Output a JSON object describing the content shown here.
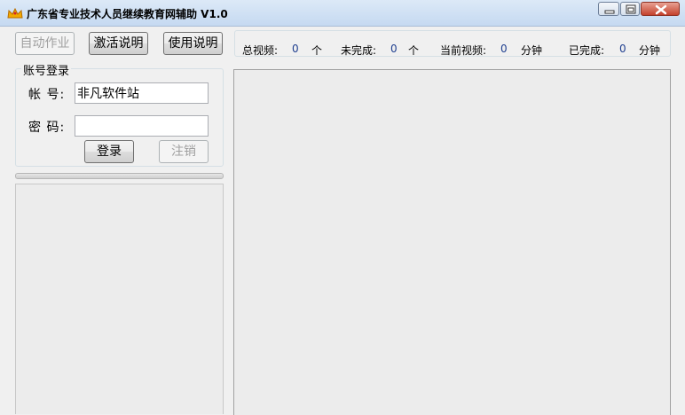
{
  "window": {
    "title": "广东省专业技术人员继续教育网辅助 V1.0",
    "icon": "crown-icon",
    "controls": [
      "minimize-icon",
      "maximize-icon",
      "close-icon"
    ]
  },
  "toolbar": {
    "auto_label": "自动作业",
    "activate_label": "激活说明",
    "usage_label": "使用说明"
  },
  "stats": {
    "total_label": "总视频:",
    "total_value": "0",
    "total_unit": "个",
    "pending_label": "未完成:",
    "pending_value": "0",
    "pending_unit": "个",
    "current_label": "当前视频:",
    "current_value": "0",
    "current_unit": "分钟",
    "done_label": "已完成:",
    "done_value": "0",
    "done_unit": "分钟"
  },
  "login": {
    "group_title": "账号登录",
    "account_label": "帐  号:",
    "account_value": "非凡软件站",
    "password_label": "密  码:",
    "password_value": "",
    "login_label": "登录",
    "logout_label": "注销"
  },
  "progress": {
    "value": 0
  },
  "colors": {
    "title_gradient_top": "#dce9f7",
    "stat_value": "#1f3f8f",
    "window_bg": "#f0f0f0"
  }
}
